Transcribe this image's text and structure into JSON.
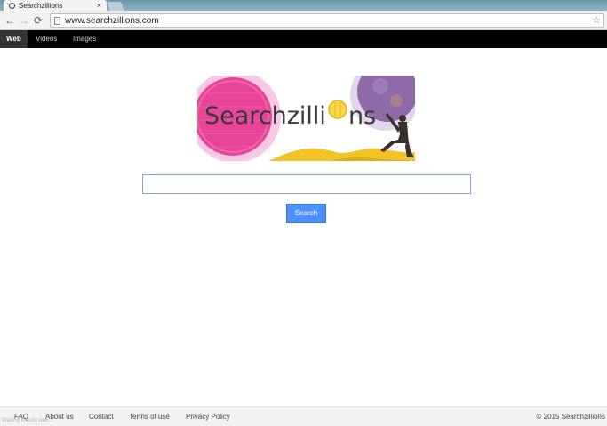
{
  "browser": {
    "tab_title": "Searchzillions",
    "tab_close": "×",
    "url": "www.searchzillions.com",
    "back_icon": "←",
    "forward_icon": "→",
    "reload_icon": "⟳",
    "star_icon": "☆"
  },
  "nav": {
    "items": [
      {
        "label": "Web",
        "active": true
      },
      {
        "label": "Videos",
        "active": false
      },
      {
        "label": "Images",
        "active": false
      }
    ]
  },
  "logo": {
    "text": "Searchzilli",
    "text_end": "ns"
  },
  "search": {
    "value": "",
    "button_label": "Search"
  },
  "footer": {
    "links": [
      "FAQ",
      "About us",
      "Contact",
      "Terms of use",
      "Privacy Policy"
    ],
    "copyright": "© 2015 Searchzillions",
    "status": "Waiting for cdn.web..."
  },
  "colors": {
    "navbar_bg": "#000000",
    "button_blue": "#4d90fe",
    "logo_pink": "#e8449a",
    "logo_purple": "#8e6aa8",
    "logo_yellow": "#f3c325"
  }
}
